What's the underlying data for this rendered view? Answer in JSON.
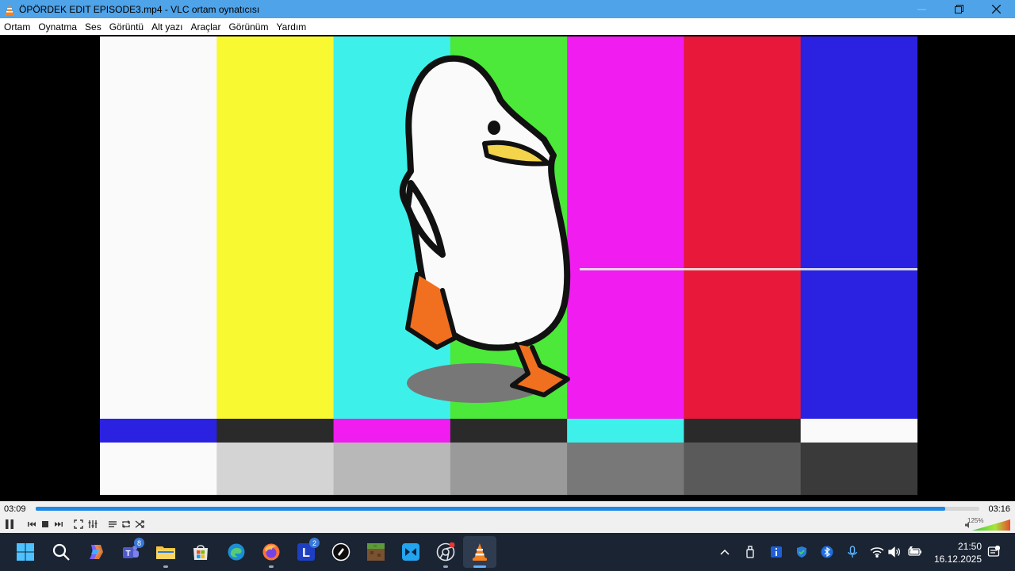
{
  "window": {
    "title": "ÖPÖRDEK EDIT EPISODE3.mp4 - VLC ortam oynatıcısı",
    "minimize_icon": "minimize-icon",
    "maximize_icon": "maximize-icon",
    "close_icon": "close-icon"
  },
  "menu": [
    "Ortam",
    "Oynatma",
    "Ses",
    "Görüntü",
    "Alt yazı",
    "Araçlar",
    "Görünüm",
    "Yardım"
  ],
  "video": {
    "content": "cartoon white duck walking in front of color test bars",
    "bar_colors": [
      "#fafafa",
      "#f9f932",
      "#3ef0ea",
      "#4ce83a",
      "#f01cf0",
      "#e8183a",
      "#2a22e0"
    ],
    "bottom_strip_colors": [
      "#2a22e0",
      "#2a2a2a",
      "#f01cf0",
      "#2a2a2a",
      "#3ef0ea",
      "#2a2a2a",
      "#fafafa"
    ],
    "gray_strip_colors": [
      "#fafafa",
      "#d4d4d4",
      "#b8b8b8",
      "#9a9a9a",
      "#787878",
      "#5a5a5a",
      "#3a3a3a"
    ]
  },
  "playback": {
    "elapsed": "03:09",
    "total": "03:16",
    "progress_fraction": 0.964,
    "accent": "#1e88e5"
  },
  "controls": {
    "buttons": [
      "pause-icon",
      "previous-icon",
      "stop-icon",
      "next-icon",
      "fullscreen-icon",
      "extended-settings-icon",
      "playlist-icon",
      "loop-icon",
      "shuffle-icon"
    ],
    "volume_label": "125%",
    "volume_fraction": 1.0
  },
  "taskbar": {
    "apps": [
      "start-icon",
      "search-icon",
      "copilot-icon",
      "teams-icon",
      "file-explorer-icon",
      "microsoft-store-icon",
      "edge-icon",
      "firefox-icon",
      "l-app-icon",
      "proton-vpn-icon",
      "minecraft-icon",
      "capcut-icon",
      "chrome-icon",
      "vlc-icon"
    ],
    "teams_badge": "8",
    "l_app_badge": "2",
    "tray": [
      "chevron-up-icon",
      "usb-icon",
      "info-icon",
      "defender-icon",
      "bluetooth-icon",
      "microphone-icon",
      "wifi-icon",
      "speaker-icon",
      "battery-icon",
      "notifications-icon"
    ],
    "time": "21:50",
    "date": "16.12.2025"
  }
}
